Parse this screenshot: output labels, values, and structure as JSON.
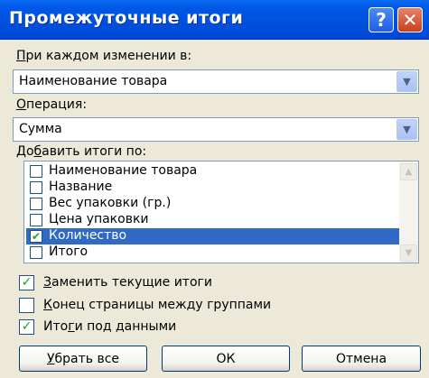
{
  "window": {
    "title": "Промежуточные итоги",
    "help_glyph": "?",
    "close_glyph": "✕"
  },
  "group_by": {
    "label_u": "П",
    "label_rest": "ри каждом изменении в:",
    "value": "Наименование товара"
  },
  "operation": {
    "label_u": "О",
    "label_rest": "перация:",
    "value": "Сумма"
  },
  "add_totals": {
    "label_pre": "До",
    "label_u": "б",
    "label_rest": "авить итоги по:",
    "items": [
      {
        "label": "Наименование товара",
        "checked": false,
        "selected": false
      },
      {
        "label": "Название",
        "checked": false,
        "selected": false
      },
      {
        "label": "Вес упаковки (гр.)",
        "checked": false,
        "selected": false
      },
      {
        "label": "Цена упаковки",
        "checked": false,
        "selected": false
      },
      {
        "label": "Количество",
        "checked": true,
        "selected": true
      },
      {
        "label": "Итого",
        "checked": false,
        "selected": false
      }
    ]
  },
  "options": {
    "replace_current": {
      "label_u": "З",
      "label_rest": "аменить текущие итоги",
      "checked": true
    },
    "page_break": {
      "label_u": "К",
      "label_rest": "онец страницы между группами",
      "checked": false
    },
    "summary_below": {
      "label_pre": "Ито",
      "label_u": "г",
      "label_rest": "и под данными",
      "checked": true
    }
  },
  "buttons": {
    "remove_all_u": "У",
    "remove_all_rest": "брать все",
    "ok": "ОК",
    "cancel": "Отмена"
  },
  "colors": {
    "titlebar": "#0054e3",
    "selection": "#316ac5",
    "check": "#21a121",
    "dialog_bg": "#ece9d8"
  },
  "icons": {
    "combo_arrow": "chevron-down-icon",
    "scroll_up": "scroll-up-icon",
    "scroll_down": "scroll-down-icon",
    "checkmark": "checkmark-icon"
  }
}
